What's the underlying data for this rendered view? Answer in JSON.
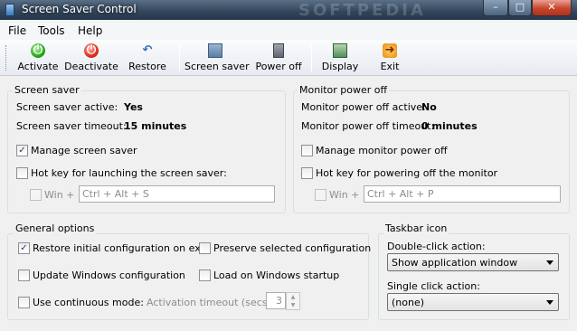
{
  "window": {
    "title": "Screen Saver Control",
    "watermark": "SOFTPEDIA",
    "minimize": "–",
    "maximize": "□",
    "close": "✕"
  },
  "menu": {
    "file": "File",
    "tools": "Tools",
    "help": "Help"
  },
  "toolbar": {
    "activate": "Activate",
    "deactivate": "Deactivate",
    "restore": "Restore",
    "screen_saver": "Screen saver",
    "power_off": "Power off",
    "display": "Display",
    "exit": "Exit"
  },
  "screen_saver": {
    "title": "Screen saver",
    "active_label": "Screen saver active:",
    "active_value": "Yes",
    "timeout_label": "Screen saver timeout:",
    "timeout_value": "15 minutes",
    "manage_label": "Manage screen saver",
    "manage_checked": true,
    "hotkey_label": "Hot key for launching the screen saver:",
    "hotkey_checked": false,
    "win_label": "Win +",
    "hotkey_value": "Ctrl + Alt + S"
  },
  "monitor": {
    "title": "Monitor power off",
    "active_label": "Monitor power off active:",
    "active_value": "No",
    "timeout_label": "Monitor power off timeout:",
    "timeout_value": "0 minutes",
    "manage_label": "Manage monitor power off",
    "manage_checked": false,
    "hotkey_label": "Hot key for powering off the monitor",
    "hotkey_checked": false,
    "win_label": "Win +",
    "hotkey_value": "Ctrl + Alt + P"
  },
  "general": {
    "title": "General options",
    "restore_label": "Restore initial configuration on exit",
    "restore_checked": true,
    "preserve_label": "Preserve selected configuration",
    "preserve_checked": false,
    "update_label": "Update Windows configuration",
    "update_checked": false,
    "load_label": "Load on Windows startup",
    "load_checked": false,
    "continuous_label": "Use continuous mode:",
    "continuous_checked": false,
    "activation_label": "Activation timeout (secs.):",
    "activation_value": "3"
  },
  "taskbar": {
    "title": "Taskbar icon",
    "double_label": "Double-click action:",
    "double_value": "Show application window",
    "single_label": "Single click action:",
    "single_value": "(none)"
  },
  "colors": {
    "titlebar": "#31445a",
    "close_button": "#c6452c",
    "group_border": "#d5dfe5"
  }
}
